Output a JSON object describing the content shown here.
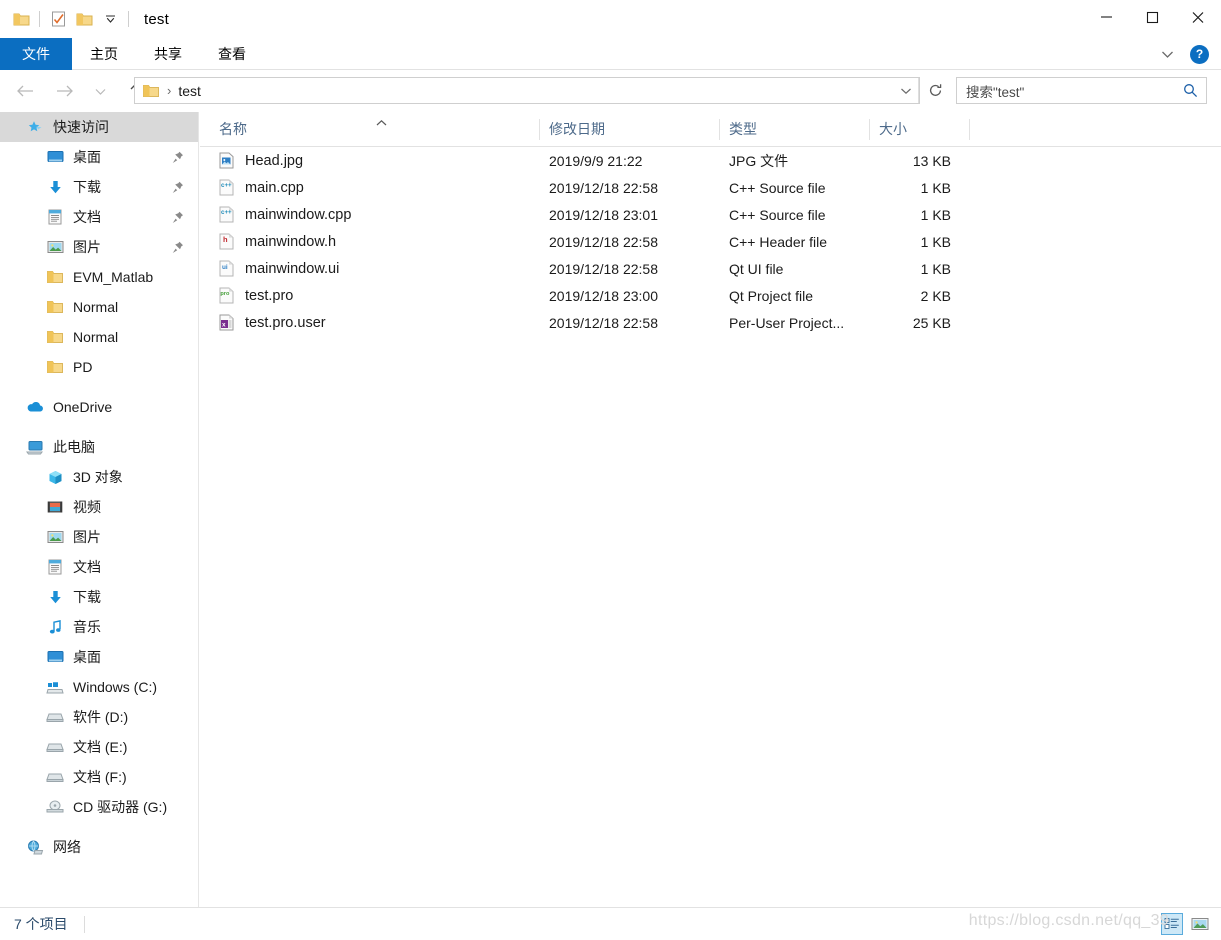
{
  "window": {
    "title": "test",
    "quick_access_toolbar": [
      {
        "name": "folder-icon",
        "label": "属性"
      },
      {
        "name": "properties-checkmark-icon",
        "label": "属性"
      },
      {
        "name": "new-folder-icon",
        "label": "新建文件夹"
      },
      {
        "name": "chevron-down-icon",
        "label": "自定义快速访问工具栏"
      }
    ],
    "controls": {
      "minimize": "—",
      "maximize": "□",
      "close": "✕"
    }
  },
  "ribbon": {
    "tabs": [
      {
        "label": "文件",
        "active": true
      },
      {
        "label": "主页",
        "active": false
      },
      {
        "label": "共享",
        "active": false
      },
      {
        "label": "查看",
        "active": false
      }
    ],
    "expand_icon": "chevron-down-icon",
    "help_label": "?"
  },
  "address": {
    "back_icon": "back-arrow-icon",
    "forward_icon": "forward-arrow-icon",
    "recent_icon": "chevron-down-icon",
    "up_icon": "up-arrow-icon",
    "breadcrumb": [
      "test"
    ],
    "separator": "›",
    "dropdown_icon": "chevron-down-icon",
    "refresh_icon": "refresh-icon"
  },
  "search": {
    "placeholder": "搜索\"test\"",
    "icon": "search-icon"
  },
  "sidebar": {
    "groups": [
      {
        "name": "quick-access",
        "header": {
          "label": "快速访问",
          "icon": "star-pin-icon",
          "selected": true
        },
        "items": [
          {
            "label": "桌面",
            "icon": "desktop-icon",
            "pinned": true
          },
          {
            "label": "下载",
            "icon": "download-icon",
            "pinned": true
          },
          {
            "label": "文档",
            "icon": "documents-icon",
            "pinned": true
          },
          {
            "label": "图片",
            "icon": "pictures-icon",
            "pinned": true
          },
          {
            "label": "EVM_Matlab",
            "icon": "folder-icon",
            "pinned": false
          },
          {
            "label": "Normal",
            "icon": "folder-icon",
            "pinned": false
          },
          {
            "label": "Normal",
            "icon": "folder-icon",
            "pinned": false
          },
          {
            "label": "PD",
            "icon": "folder-icon",
            "pinned": false
          }
        ]
      },
      {
        "name": "onedrive",
        "header": {
          "label": "OneDrive",
          "icon": "onedrive-cloud-icon",
          "selected": false
        },
        "items": []
      },
      {
        "name": "this-pc",
        "header": {
          "label": "此电脑",
          "icon": "this-pc-icon",
          "selected": false
        },
        "items": [
          {
            "label": "3D 对象",
            "icon": "3d-objects-icon",
            "pinned": false
          },
          {
            "label": "视频",
            "icon": "videos-icon",
            "pinned": false
          },
          {
            "label": "图片",
            "icon": "pictures-icon",
            "pinned": false
          },
          {
            "label": "文档",
            "icon": "documents-icon",
            "pinned": false
          },
          {
            "label": "下载",
            "icon": "download-icon",
            "pinned": false
          },
          {
            "label": "音乐",
            "icon": "music-icon",
            "pinned": false
          },
          {
            "label": "桌面",
            "icon": "desktop-icon",
            "pinned": false
          },
          {
            "label": "Windows (C:)",
            "icon": "windows-drive-icon",
            "pinned": false
          },
          {
            "label": "软件 (D:)",
            "icon": "drive-icon",
            "pinned": false
          },
          {
            "label": "文档 (E:)",
            "icon": "drive-icon",
            "pinned": false
          },
          {
            "label": "文档 (F:)",
            "icon": "drive-icon",
            "pinned": false
          },
          {
            "label": "CD 驱动器 (G:)",
            "icon": "cd-drive-icon",
            "pinned": false
          }
        ]
      },
      {
        "name": "network",
        "header": {
          "label": "网络",
          "icon": "network-icon",
          "selected": false
        },
        "items": []
      }
    ]
  },
  "file_list": {
    "columns": [
      {
        "key": "name",
        "label": "名称",
        "sorted": "asc"
      },
      {
        "key": "date",
        "label": "修改日期",
        "sorted": null
      },
      {
        "key": "type",
        "label": "类型",
        "sorted": null
      },
      {
        "key": "size",
        "label": "大小",
        "sorted": null
      }
    ],
    "rows": [
      {
        "name": "Head.jpg",
        "date": "2019/9/9 21:22",
        "type": "JPG 文件",
        "size": "13 KB",
        "icon": "jpg-file-icon"
      },
      {
        "name": "main.cpp",
        "date": "2019/12/18 22:58",
        "type": "C++ Source file",
        "size": "1 KB",
        "icon": "cpp-file-icon"
      },
      {
        "name": "mainwindow.cpp",
        "date": "2019/12/18 23:01",
        "type": "C++ Source file",
        "size": "1 KB",
        "icon": "cpp-file-icon"
      },
      {
        "name": "mainwindow.h",
        "date": "2019/12/18 22:58",
        "type": "C++ Header file",
        "size": "1 KB",
        "icon": "h-file-icon"
      },
      {
        "name": "mainwindow.ui",
        "date": "2019/12/18 22:58",
        "type": "Qt UI file",
        "size": "1 KB",
        "icon": "ui-file-icon"
      },
      {
        "name": "test.pro",
        "date": "2019/12/18 23:00",
        "type": "Qt Project file",
        "size": "2 KB",
        "icon": "pro-file-icon"
      },
      {
        "name": "test.pro.user",
        "date": "2019/12/18 22:58",
        "type": "Per-User Project...",
        "size": "25 KB",
        "icon": "user-project-file-icon"
      }
    ]
  },
  "status": {
    "item_count": "7 个项目",
    "view_buttons": [
      {
        "name": "details-view-button",
        "active": true
      },
      {
        "name": "thumbnail-view-button",
        "active": false
      }
    ],
    "watermark": "https://blog.csdn.net/qq_39"
  },
  "colors": {
    "accent": "#0b6ec1",
    "header_text": "#4d6a8a",
    "selection": "#d9d9d9",
    "status_text": "#2b4b6b"
  }
}
